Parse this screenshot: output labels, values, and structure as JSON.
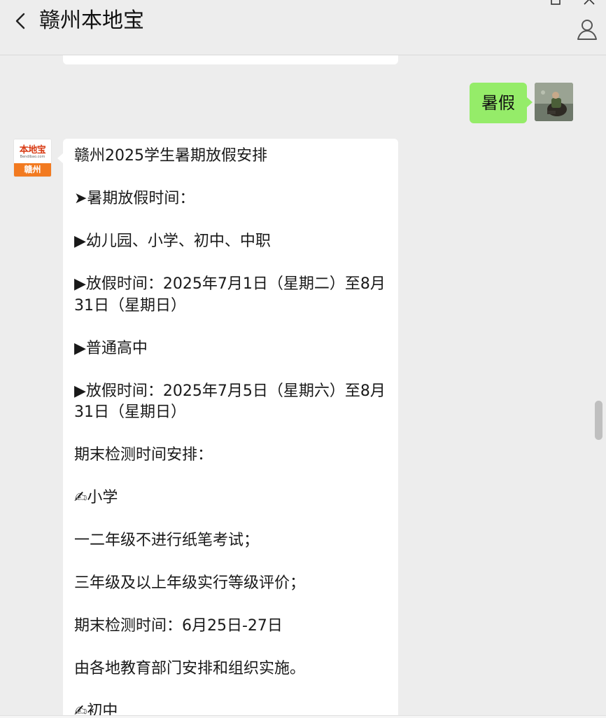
{
  "header": {
    "title": "赣州本地宝",
    "back_icon": "chevron-left-icon",
    "profile_icon": "person-icon",
    "window_controls": [
      "maximize-icon",
      "close-icon"
    ]
  },
  "chat": {
    "outgoing": {
      "text": "暑假"
    },
    "incoming": {
      "avatar": {
        "logo_text": "本地宝",
        "logo_url": "Bendibao.com",
        "city": "赣州"
      },
      "lines": [
        "赣州2025学生暑期放假安排",
        "➤暑期放假时间：",
        "▶幼儿园、小学、初中、中职",
        "▶放假时间：2025年7月1日（星期二）至8月31日（星期日）",
        "▶普通高中",
        "▶放假时间：2025年7月5日（星期六）至8月31日（星期日）",
        "期末检测时间安排：",
        "✍小学",
        "一二年级不进行纸笔考试；",
        "三年级及以上年级实行等级评价；",
        "期末检测时间：6月25日-27日",
        "由各地教育部门安排和组织实施。",
        "✍初中"
      ]
    }
  },
  "colors": {
    "background": "#ededed",
    "outgoing_bubble": "#95ec69",
    "incoming_bubble": "#ffffff",
    "logo_red": "#d83b14",
    "logo_orange": "#f27a20"
  }
}
